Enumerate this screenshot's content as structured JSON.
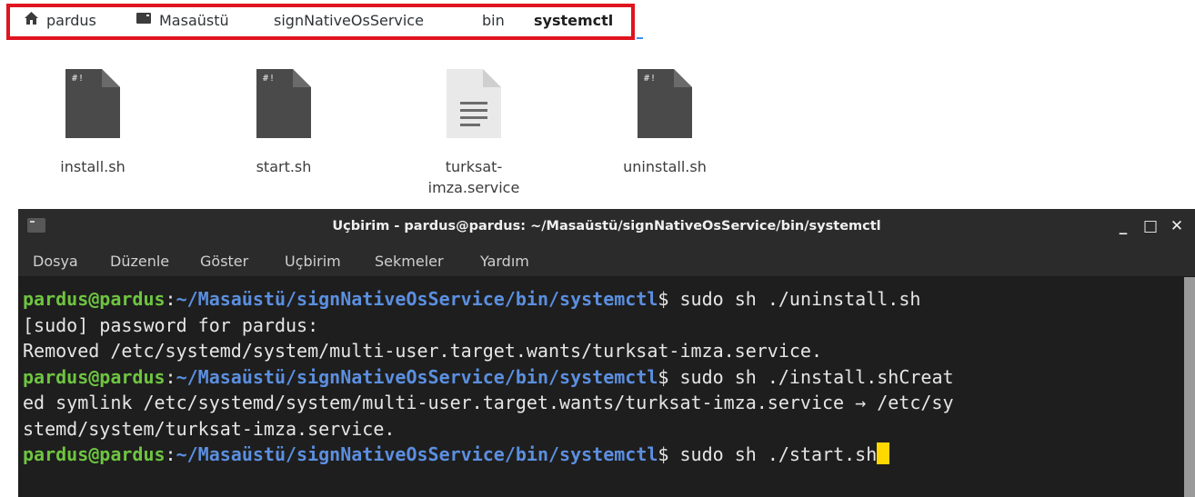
{
  "breadcrumb": {
    "items": [
      {
        "label": "pardus",
        "icon": "home-icon"
      },
      {
        "label": "Masaüstü",
        "icon": "desktop-icon"
      },
      {
        "label": "signNativeOsService"
      },
      {
        "label": "bin"
      },
      {
        "label": "systemctl",
        "active": true
      }
    ],
    "highlight_color": "#e0141e"
  },
  "files": [
    {
      "name": "install.sh",
      "icon": "shell-script-icon",
      "badge": "#!"
    },
    {
      "name": "start.sh",
      "icon": "shell-script-icon",
      "badge": "#!"
    },
    {
      "name_line1": "turksat-",
      "name_line2": "imza.service",
      "icon": "text-file-icon"
    },
    {
      "name": "uninstall.sh",
      "icon": "shell-script-icon",
      "badge": "#!"
    }
  ],
  "terminal": {
    "title": "Uçbirim - pardus@pardus: ~/Masaüstü/signNativeOsService/bin/systemctl",
    "buttons": {
      "minimize": "_",
      "maximize": "□",
      "close": "✕"
    },
    "menu": [
      "Dosya",
      "Düzenle",
      "Göster",
      "Uçbirim",
      "Sekmeler",
      "Yardım"
    ],
    "prompt_user": "pardus@pardus",
    "prompt_sep": ":",
    "prompt_path": "~/Masaüstü/signNativeOsService/bin/systemctl",
    "prompt_tail": "$ ",
    "lines": {
      "cmd1": "sudo sh ./uninstall.sh",
      "out1": "[sudo] password for pardus:",
      "out2": "Removed /etc/systemd/system/multi-user.target.wants/turksat-imza.service.",
      "cmd2": "sudo sh ./install.shCreat",
      "out3": "ed symlink /etc/systemd/system/multi-user.target.wants/turksat-imza.service → /etc/sy",
      "out4": "stemd/system/turksat-imza.service.",
      "cmd3": "sudo sh ./start.sh"
    },
    "colors": {
      "user": "#6ec540",
      "path": "#5b8fe0",
      "cursor": "#ffd800"
    }
  }
}
